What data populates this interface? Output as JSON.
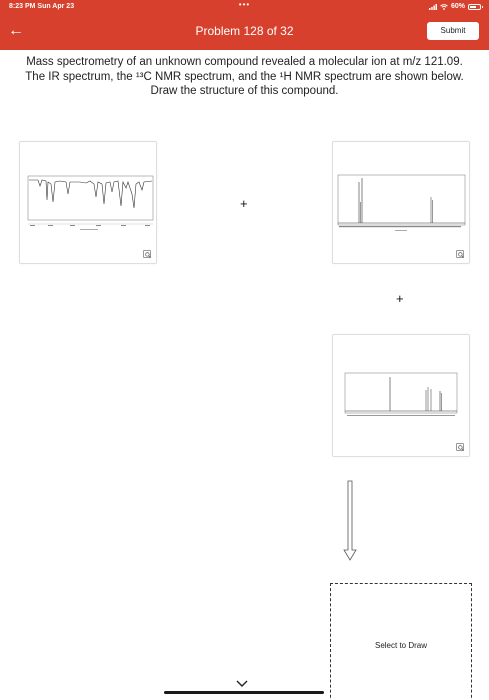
{
  "status_bar": {
    "time": "8:23 PM  Sun Apr 23",
    "dots": "•••",
    "battery": "60%"
  },
  "nav": {
    "back_icon": "←",
    "title": "Problem 128 of 32",
    "submit_label": "Submit"
  },
  "problem": {
    "line1": "Mass spectrometry of an unknown compound revealed a molecular ion at m/z 121.09.",
    "line2": "The IR spectrum, the ¹³C NMR spectrum, and the ¹H NMR spectrum are shown below.",
    "line3": "Draw the structure of this compound."
  },
  "operators": {
    "plus_1": "+",
    "plus_2": "+"
  },
  "draw_area": {
    "label": "Select to Draw"
  },
  "colors": {
    "accent": "#d8402e"
  }
}
